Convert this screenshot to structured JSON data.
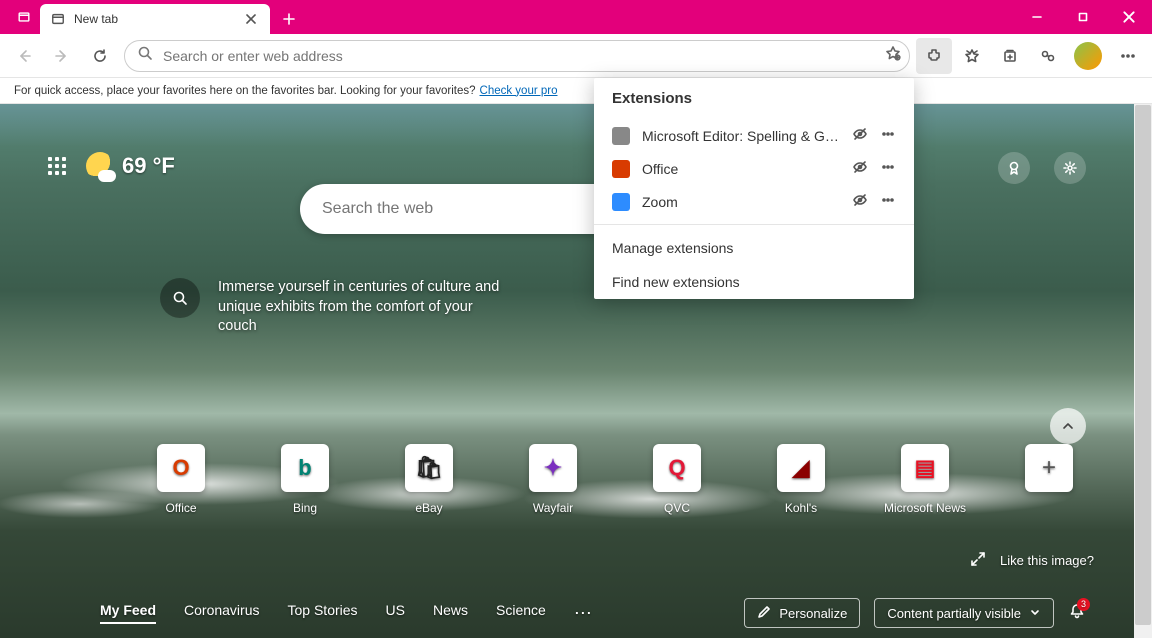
{
  "tab": {
    "title": "New tab"
  },
  "omnibox": {
    "placeholder": "Search or enter web address"
  },
  "favbar": {
    "text": "For quick access, place your favorites here on the favorites bar. Looking for your favorites?",
    "link": "Check your pro"
  },
  "ntp": {
    "temp": "69 °F",
    "search_placeholder": "Search the web",
    "promo": "Immerse yourself in centuries of culture and unique exhibits from the comfort of your couch",
    "like_image": "Like this image?",
    "sites": [
      {
        "label": "Office",
        "letter": "O",
        "color": "#d83b01"
      },
      {
        "label": "Bing",
        "letter": "b",
        "color": "#008373"
      },
      {
        "label": "eBay",
        "letter": "🛍",
        "color": "#222"
      },
      {
        "label": "Wayfair",
        "letter": "✦",
        "color": "#7b2fbf"
      },
      {
        "label": "QVC",
        "letter": "Q",
        "color": "#e31837"
      },
      {
        "label": "Kohl's",
        "letter": "◢",
        "color": "#8b0000"
      },
      {
        "label": "Microsoft News",
        "letter": "▤",
        "color": "#e81123"
      }
    ]
  },
  "feed": {
    "tabs": [
      "My Feed",
      "Coronavirus",
      "Top Stories",
      "US",
      "News",
      "Science"
    ],
    "personalize": "Personalize",
    "content_mode": "Content partially visible",
    "badge": "3"
  },
  "ext": {
    "title": "Extensions",
    "items": [
      {
        "name": "Microsoft Editor: Spelling & Gram…",
        "color": "#888"
      },
      {
        "name": "Office",
        "color": "#d83b01"
      },
      {
        "name": "Zoom",
        "color": "#2d8cff"
      }
    ],
    "manage": "Manage extensions",
    "find": "Find new extensions"
  }
}
